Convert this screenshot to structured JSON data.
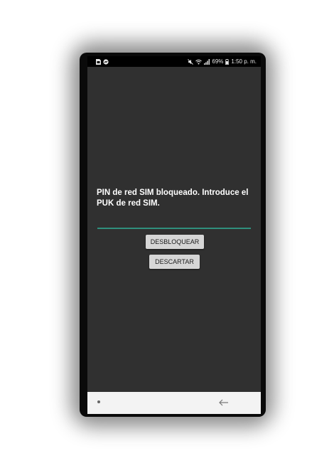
{
  "status_bar": {
    "left_icons": [
      "sim-card-icon",
      "messenger-icon"
    ],
    "right_icons": [
      "mute-icon",
      "wifi-icon",
      "signal-icon"
    ],
    "battery": "69%",
    "time": "1:50 p. m."
  },
  "dialog": {
    "message": "PIN de red SIM bloqueado. Introduce el PUK de red SIM.",
    "input_value": "",
    "unlock_label": "DESBLOQUEAR",
    "dismiss_label": "DESCARTAR"
  },
  "nav_bar": {
    "icons": [
      "recents-dot-icon",
      "back-arrow-icon"
    ]
  },
  "colors": {
    "screen_bg": "#303030",
    "accent": "#2f8f7d",
    "button_bg": "#d6d6d6"
  }
}
